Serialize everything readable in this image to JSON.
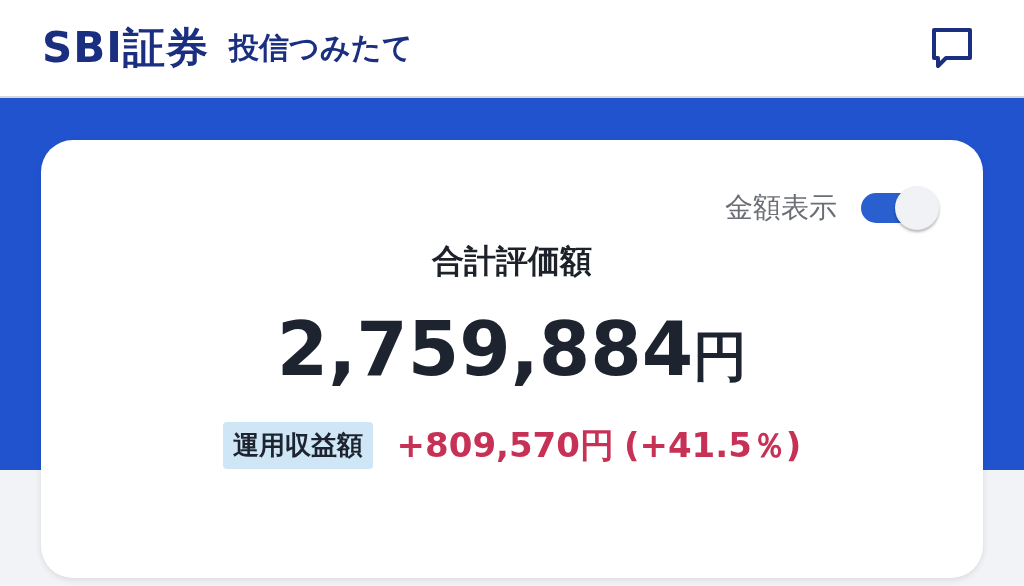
{
  "header": {
    "logo": "SBI証券",
    "title": "投信つみたて"
  },
  "card": {
    "toggle": {
      "label": "金額表示",
      "on": true
    },
    "total_label": "合計評価額",
    "total_value": "2,759,884",
    "total_unit": "円",
    "profit": {
      "label": "運用収益額",
      "value": "+809,570円",
      "percent": "(+41.5％)"
    }
  }
}
